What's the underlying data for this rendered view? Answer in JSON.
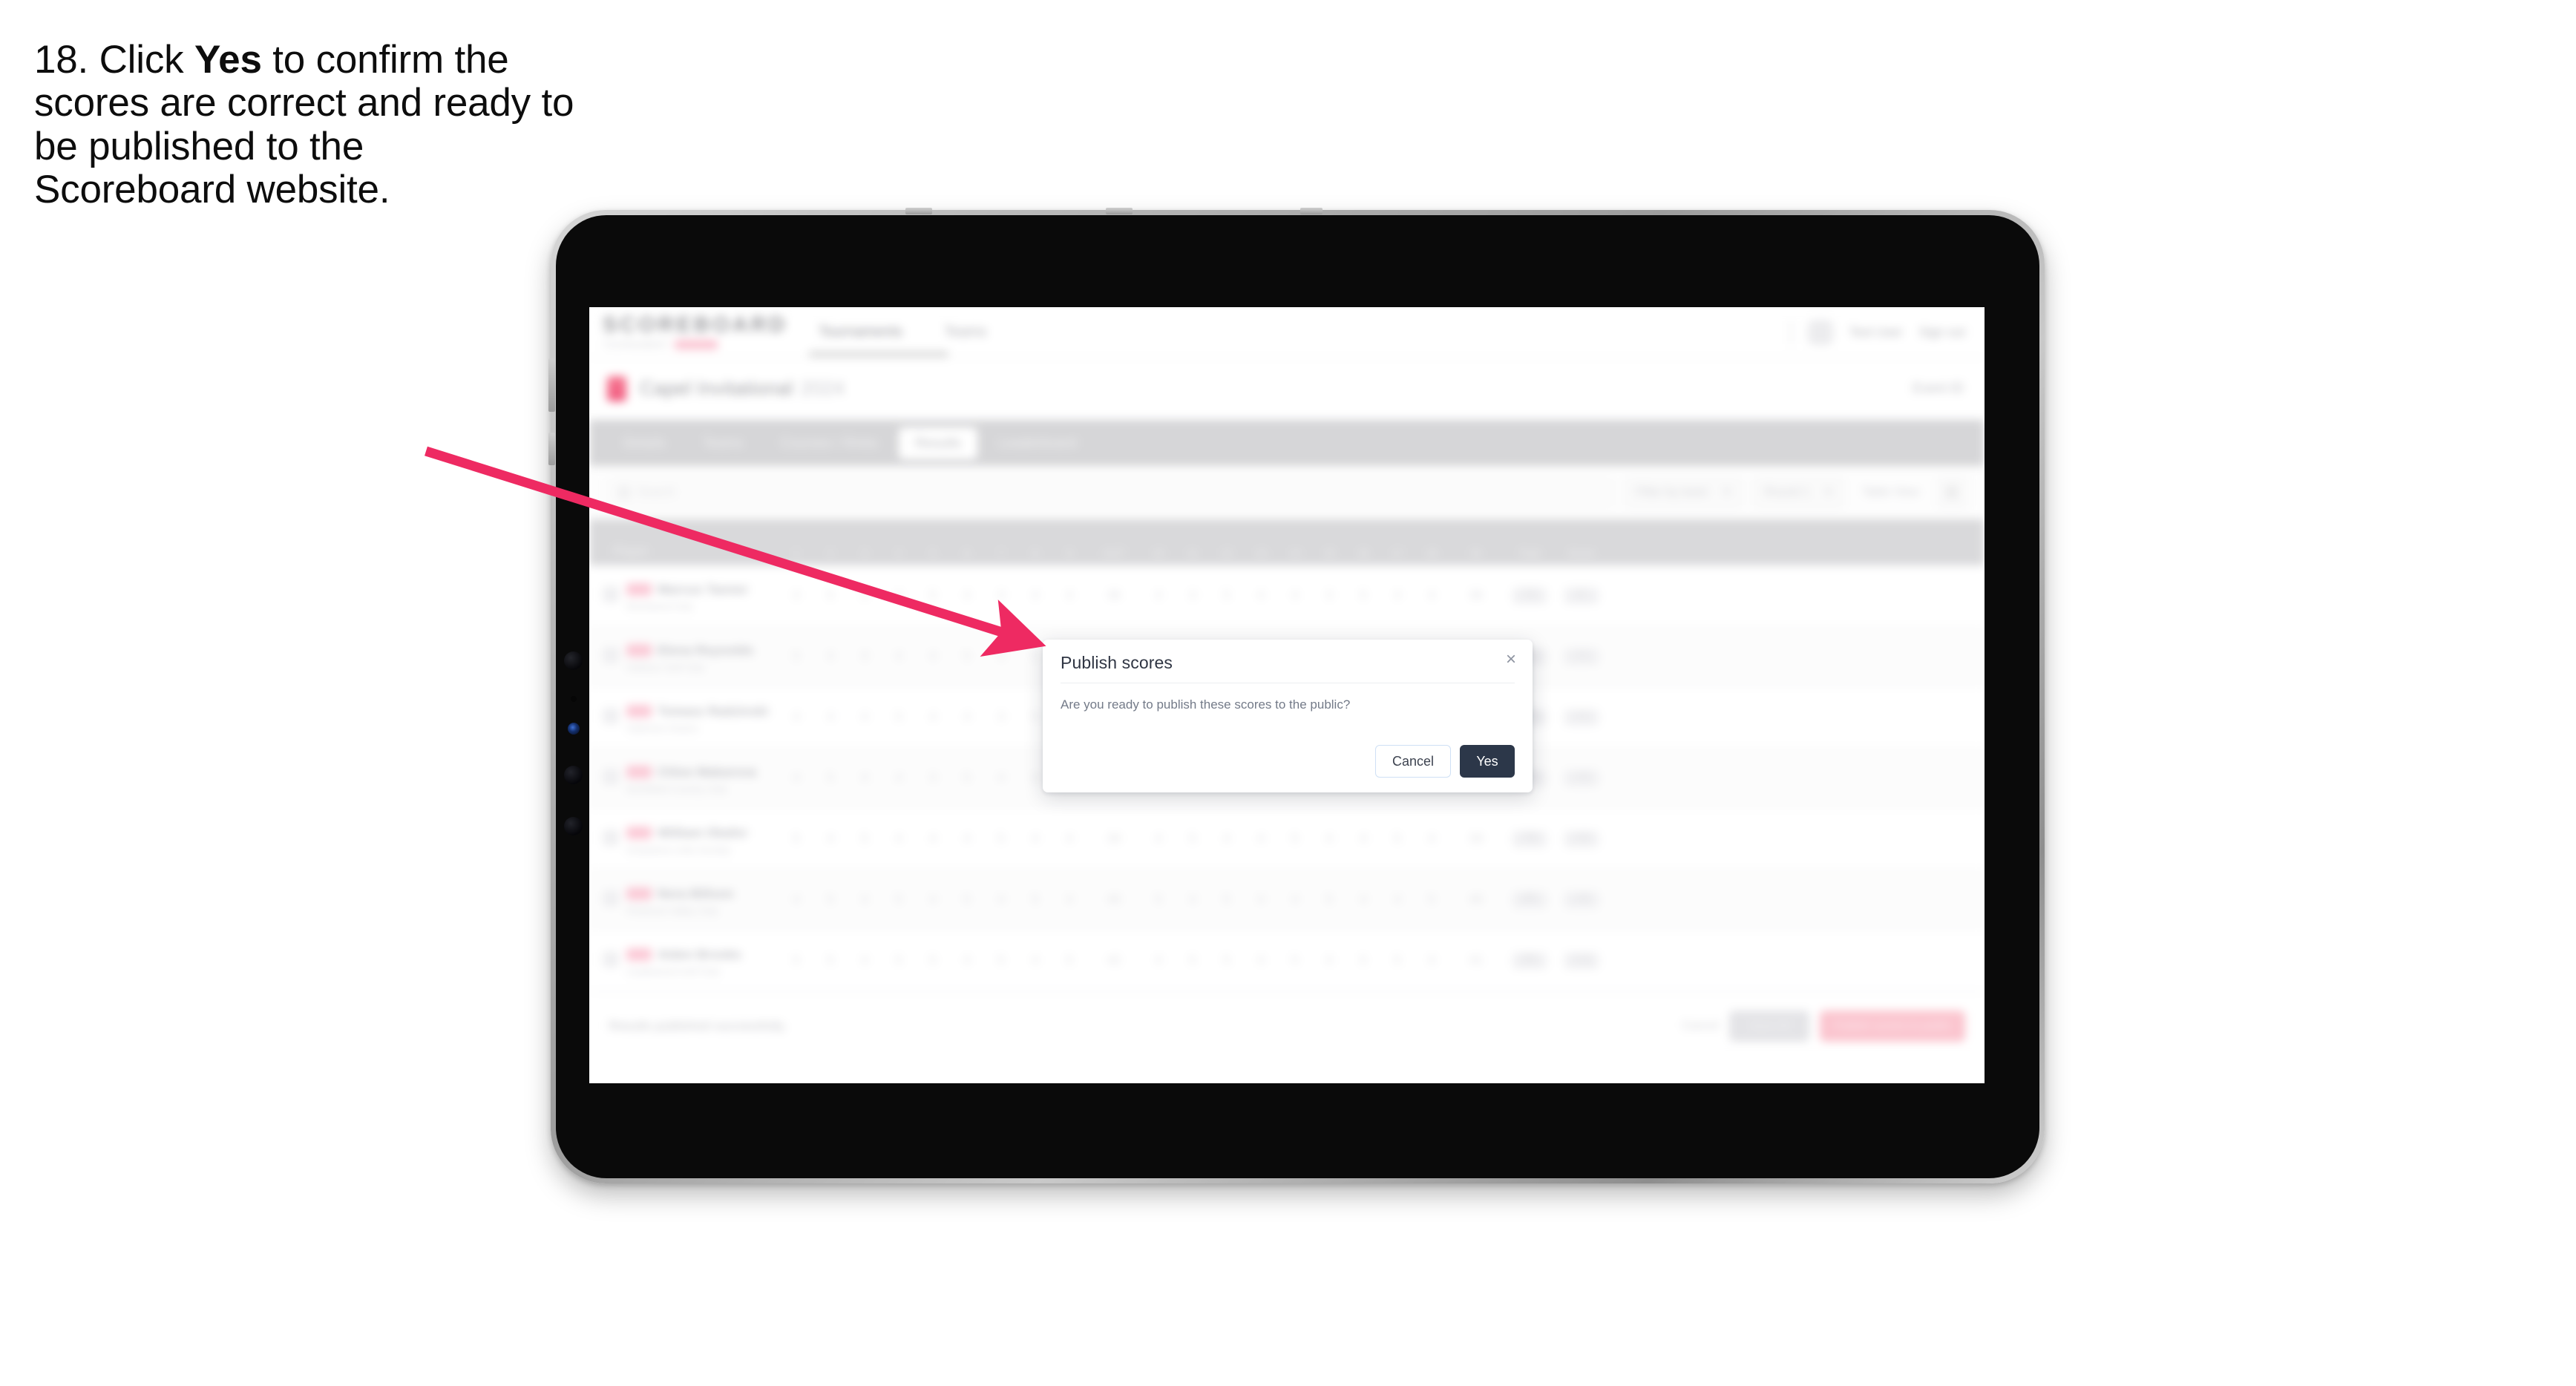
{
  "caption": {
    "prefix": "18. Click ",
    "bold": "Yes",
    "suffix": " to confirm the scores are correct and ready to be published to the Scoreboard website."
  },
  "colors": {
    "arrow": "#EE2A62",
    "primary_button": "#2C3749",
    "accent_pink": "#EF3E68",
    "tab_bar": "#D6D6D8",
    "bezel": "#0A0A0A"
  },
  "modal": {
    "title": "Publish scores",
    "body": "Are you ready to publish these scores to the public?",
    "close_icon": "×",
    "cancel_label": "Cancel",
    "yes_label": "Yes"
  },
  "app": {
    "brand": {
      "word": "SCOREBOARD",
      "sub": "TOURNAMENT"
    },
    "nav_links": [
      {
        "label": "Tournaments",
        "active": true
      },
      {
        "label": "Teams",
        "active": false
      }
    ],
    "nav_right": {
      "user": "Test User",
      "signout": "Sign out"
    },
    "event": {
      "title": "Capel Invitational",
      "year": "2024",
      "right": "Event ID"
    },
    "tabs": [
      {
        "label": "Details",
        "active": false
      },
      {
        "label": "Teams",
        "active": false
      },
      {
        "label": "Courses / Rinks",
        "active": false
      },
      {
        "label": "Results",
        "active": true
      },
      {
        "label": "Leaderboard",
        "active": false
      }
    ],
    "filters": {
      "search_placeholder": "Search",
      "dropdown_1": "Filter by team",
      "dropdown_2": "Round 1",
      "ghost_label": "Table View",
      "icon_button": "settings-icon"
    },
    "table": {
      "columns": [
        "Player",
        "1",
        "2",
        "3",
        "4",
        "5",
        "6",
        "7",
        "8",
        "9",
        "OUT",
        "10",
        "11",
        "12",
        "13",
        "14",
        "15",
        "16",
        "17",
        "18",
        "IN",
        "Total",
        "Score"
      ],
      "rows": [
        {
          "badge": "AM",
          "name": "Marcus Tanner",
          "sub": "Riverbend Club",
          "scores": [
            "4",
            "5",
            "3",
            "4",
            "5",
            "4",
            "3",
            "4",
            "4",
            "36",
            "4",
            "3",
            "5",
            "4",
            "4",
            "3",
            "5",
            "4",
            "4",
            "36",
            "72",
            "E"
          ]
        },
        {
          "badge": "AM",
          "name": "Elena Reynolds",
          "sub": "Harbour Golf Club",
          "scores": [
            "5",
            "4",
            "3",
            "4",
            "4",
            "5",
            "4",
            "3",
            "4",
            "36",
            "4",
            "4",
            "4",
            "5",
            "3",
            "4",
            "4",
            "4",
            "5",
            "37",
            "73",
            "+1"
          ]
        },
        {
          "badge": "AM",
          "name": "Tomasz Radzinski",
          "sub": "Oakmoor Downs",
          "scores": [
            "4",
            "4",
            "4",
            "5",
            "4",
            "4",
            "3",
            "5",
            "4",
            "37",
            "5",
            "4",
            "3",
            "4",
            "4",
            "5",
            "4",
            "3",
            "4",
            "36",
            "73",
            "+1"
          ]
        },
        {
          "badge": "AM",
          "name": "Chloe Makarova",
          "sub": "Northfield Country Club",
          "scores": [
            "4",
            "5",
            "4",
            "4",
            "3",
            "5",
            "4",
            "4",
            "5",
            "38",
            "4",
            "4",
            "5",
            "3",
            "4",
            "4",
            "5",
            "4",
            "4",
            "37",
            "75",
            "+3"
          ]
        },
        {
          "badge": "AM",
          "name": "William Okafor",
          "sub": "Greystone Links Society",
          "scores": [
            "5",
            "4",
            "5",
            "4",
            "4",
            "4",
            "5",
            "4",
            "4",
            "39",
            "4",
            "5",
            "4",
            "4",
            "5",
            "4",
            "4",
            "5",
            "4",
            "39",
            "78",
            "+6"
          ]
        },
        {
          "badge": "AM",
          "name": "Nora Billson",
          "sub": "Pinehurst Valley Club",
          "scores": [
            "4",
            "5",
            "4",
            "5",
            "4",
            "5",
            "4",
            "5",
            "4",
            "40",
            "5",
            "4",
            "5",
            "4",
            "4",
            "5",
            "4",
            "4",
            "5",
            "40",
            "80",
            "+8"
          ]
        },
        {
          "badge": "AM",
          "name": "Aiden Brooks",
          "sub": "Castlewood Golf Club",
          "scores": [
            "5",
            "5",
            "4",
            "5",
            "5",
            "4",
            "5",
            "4",
            "5",
            "42",
            "4",
            "5",
            "5",
            "4",
            "5",
            "4",
            "5",
            "5",
            "4",
            "41",
            "83",
            "+11"
          ]
        }
      ]
    },
    "footer": {
      "note": "Results published successfully.",
      "link": "Cancel",
      "secondary_button": "Save All",
      "primary_button": "Publish scores to public"
    }
  }
}
